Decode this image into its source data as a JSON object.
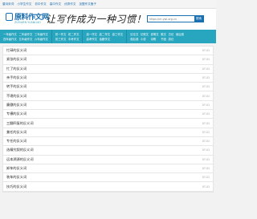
{
  "topnav": [
    "唐诗宋词",
    "小学生作文",
    "初中作文",
    "高中作文",
    "优秀作文",
    "加盟作文备子"
  ],
  "logo": {
    "title": "原料作文网",
    "subtitle": "ZUOWEN YUANLIAO"
  },
  "slogan": "让写作成为一种习惯！",
  "search": {
    "placeholder": "https://m.ywl.org.cn",
    "button": "搜索"
  },
  "categories": [
    [
      "一年级作文",
      "二年级作文",
      "三年级作文",
      "四年级作文",
      "五年级作文",
      "六年级作文"
    ],
    [
      "初一作文",
      "初二作文",
      "初三作文",
      "中考作文"
    ],
    [
      "高一作文",
      "高二作文",
      "高三作文",
      "高考作文",
      "话题作文"
    ],
    [
      "议论文",
      "记叙文",
      "说明文",
      "散文",
      "日记",
      "读后感",
      "观后感",
      "小说",
      "诗歌",
      "书信",
      "游记"
    ]
  ],
  "rows": [
    {
      "title": "忙碌的反义词",
      "date": "07-01"
    },
    {
      "title": "紧张的反义词",
      "date": "07-01"
    },
    {
      "title": "忙了的反义词",
      "date": "07-01"
    },
    {
      "title": "亲手的反义词",
      "date": "07-01"
    },
    {
      "title": "转手的反义词",
      "date": "07-01"
    },
    {
      "title": "不堪的反义词",
      "date": "07-01"
    },
    {
      "title": "廉傲的反义词",
      "date": "07-01"
    },
    {
      "title": "专横的反义词",
      "date": "07-01"
    },
    {
      "title": "三翻四复的反义词",
      "date": "07-01"
    },
    {
      "title": "兼任的反义词",
      "date": "07-01"
    },
    {
      "title": "专任的反义词",
      "date": "07-01"
    },
    {
      "title": "选精究叙的反义词",
      "date": "07-01"
    },
    {
      "title": "远本溯源的反义词",
      "date": "07-01"
    },
    {
      "title": "卸车的反义词",
      "date": "07-01"
    },
    {
      "title": "装车的反义词",
      "date": "07-01"
    },
    {
      "title": "技巧的反义词",
      "date": "07-01"
    }
  ]
}
